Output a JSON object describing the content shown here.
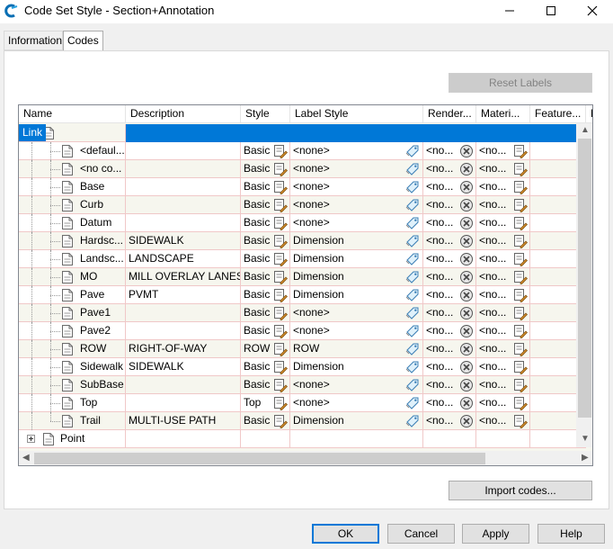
{
  "window": {
    "title": "Code Set Style - Section+Annotation",
    "icon": "civil3d-app-icon"
  },
  "tabs": [
    {
      "label": "Information",
      "active": false
    },
    {
      "label": "Codes",
      "active": true
    }
  ],
  "buttons": {
    "reset_labels": "Reset Labels",
    "import_codes": "Import codes...",
    "ok": "OK",
    "cancel": "Cancel",
    "apply": "Apply",
    "help": "Help"
  },
  "grid": {
    "columns": [
      "Name",
      "Description",
      "Style",
      "Label Style",
      "Render...",
      "Materi...",
      "Feature...",
      "P"
    ],
    "groups": [
      {
        "name": "Link",
        "expanded": true,
        "selected": true
      },
      {
        "name": "Point",
        "expanded": false,
        "selected": false
      }
    ],
    "rows": [
      {
        "name": "<defaul...",
        "description": "",
        "style": "Basic",
        "label_style": "<none>",
        "render": "<no...",
        "material": "<no..."
      },
      {
        "name": "<no co...",
        "description": "",
        "style": "Basic",
        "label_style": "<none>",
        "render": "<no...",
        "material": "<no..."
      },
      {
        "name": "Base",
        "description": "",
        "style": "Basic",
        "label_style": "<none>",
        "render": "<no...",
        "material": "<no..."
      },
      {
        "name": "Curb",
        "description": "",
        "style": "Basic",
        "label_style": "<none>",
        "render": "<no...",
        "material": "<no..."
      },
      {
        "name": "Datum",
        "description": "",
        "style": "Basic",
        "label_style": "<none>",
        "render": "<no...",
        "material": "<no..."
      },
      {
        "name": "Hardsc...",
        "description": "SIDEWALK",
        "style": "Basic",
        "label_style": "Dimension",
        "render": "<no...",
        "material": "<no..."
      },
      {
        "name": "Landsc...",
        "description": "LANDSCAPE",
        "style": "Basic",
        "label_style": "Dimension",
        "render": "<no...",
        "material": "<no..."
      },
      {
        "name": "MO",
        "description": "MILL OVERLAY LANES",
        "style": "Basic",
        "label_style": "Dimension",
        "render": "<no...",
        "material": "<no..."
      },
      {
        "name": "Pave",
        "description": "PVMT",
        "style": "Basic",
        "label_style": "Dimension",
        "render": "<no...",
        "material": "<no..."
      },
      {
        "name": "Pave1",
        "description": "",
        "style": "Basic",
        "label_style": "<none>",
        "render": "<no...",
        "material": "<no..."
      },
      {
        "name": "Pave2",
        "description": "",
        "style": "Basic",
        "label_style": "<none>",
        "render": "<no...",
        "material": "<no..."
      },
      {
        "name": "ROW",
        "description": "RIGHT-OF-WAY",
        "style": "ROW",
        "label_style": "ROW",
        "render": "<no...",
        "material": "<no..."
      },
      {
        "name": "Sidewalk",
        "description": "SIDEWALK",
        "style": "Basic",
        "label_style": "Dimension",
        "render": "<no...",
        "material": "<no..."
      },
      {
        "name": "SubBase",
        "description": "",
        "style": "Basic",
        "label_style": "<none>",
        "render": "<no...",
        "material": "<no..."
      },
      {
        "name": "Top",
        "description": "",
        "style": "Top",
        "label_style": "<none>",
        "render": "<no...",
        "material": "<no..."
      },
      {
        "name": "Trail",
        "description": "MULTI-USE PATH",
        "style": "Basic",
        "label_style": "Dimension",
        "render": "<no...",
        "material": "<no..."
      }
    ]
  },
  "colors": {
    "selection": "#0078d7",
    "row_alt": "#f6f6ee",
    "grid_line": "#f0c8c8"
  },
  "icons": {
    "style_edit": "style-edit-icon",
    "label_tag": "label-tag-icon",
    "render_clear": "render-clear-icon",
    "material_edit": "material-edit-icon",
    "code_doc": "code-document-icon"
  }
}
